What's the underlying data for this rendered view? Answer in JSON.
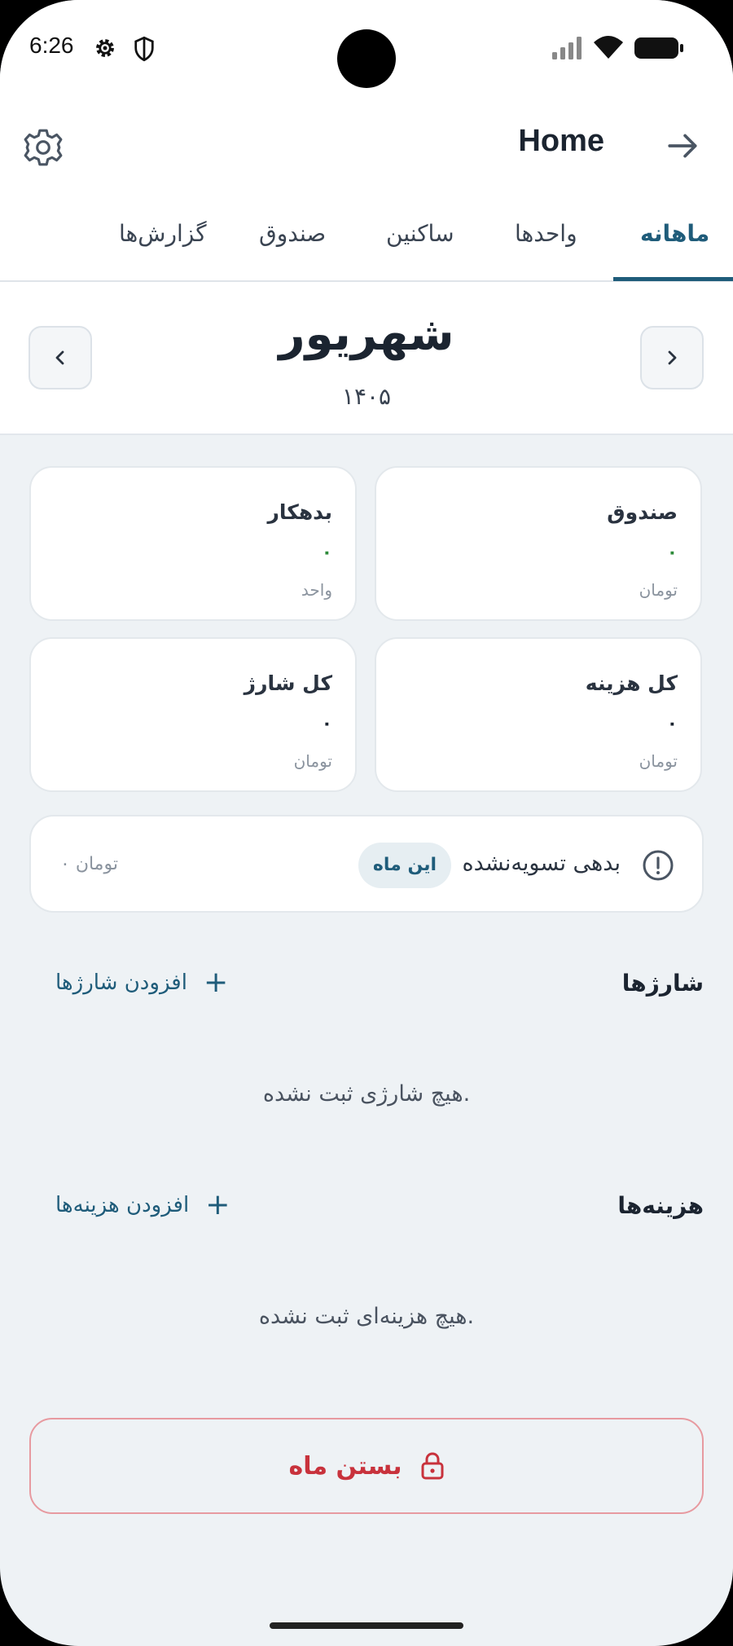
{
  "status_bar": {
    "time": "6:26"
  },
  "header": {
    "title": "Home"
  },
  "tabs": [
    {
      "label": "ماهانه",
      "active": true
    },
    {
      "label": "واحدها",
      "active": false
    },
    {
      "label": "ساکنین",
      "active": false
    },
    {
      "label": "صندوق",
      "active": false
    },
    {
      "label": "گزارش‌ها",
      "active": false
    }
  ],
  "month": {
    "name": "شهریور",
    "year": "۱۴۰۵"
  },
  "cards": [
    {
      "title": "صندوق",
      "value": "۰",
      "unit": "تومان"
    },
    {
      "title": "بدهکار",
      "value": "۰",
      "unit": "واحد"
    },
    {
      "title": "کل هزینه",
      "value": "۰",
      "unit": "تومان"
    },
    {
      "title": "کل شارژ",
      "value": "۰",
      "unit": "تومان"
    }
  ],
  "debt": {
    "label": "بدهی تسویه‌نشده",
    "badge": "این ماه",
    "amount": "۰ تومان"
  },
  "charges": {
    "title": "شارژها",
    "add_label": "افزودن شارژها",
    "empty": "هیچ شارژی ثبت نشده."
  },
  "expenses": {
    "title": "هزینه‌ها",
    "add_label": "افزودن هزینه‌ها",
    "empty": "هیچ هزینه‌ای ثبت نشده."
  },
  "close_month": {
    "label": "بستن ماه"
  },
  "colors": {
    "accent": "#1f5c7a",
    "danger": "#c8323c",
    "positive": "#2e8b3a",
    "background": "#eef2f5"
  }
}
